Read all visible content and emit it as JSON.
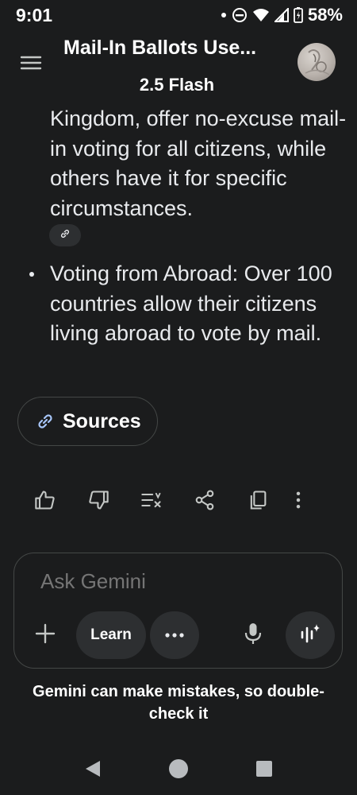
{
  "status_bar": {
    "time": "9:01",
    "battery": "58%",
    "icons": [
      "notification-dot-icon",
      "do-not-disturb-icon",
      "wifi-icon",
      "cellular-signal-icon",
      "battery-icon"
    ]
  },
  "header": {
    "title": "Mail-In Ballots Use...",
    "model": "2.5 Flash",
    "menu_icon": "hamburger-menu-icon",
    "avatar_icon": "user-avatar"
  },
  "response": {
    "paragraph_1": "Kingdom, offer no-excuse mail-in voting for all citizens, while others have it for specific circumstances.",
    "bullet_1": "Voting from Abroad: Over 100 countries allow their citizens living abroad to vote by mail.",
    "citation_icon": "link-icon",
    "sources_label": "Sources"
  },
  "actions": [
    {
      "name": "thumbs-up-icon"
    },
    {
      "name": "thumbs-down-icon"
    },
    {
      "name": "modify-response-icon"
    },
    {
      "name": "share-icon"
    },
    {
      "name": "copy-icon"
    },
    {
      "name": "more-vert-icon"
    }
  ],
  "composer": {
    "placeholder": "Ask Gemini",
    "learn_label": "Learn",
    "plus_icon": "plus-icon",
    "more_icon": "more-horiz-icon",
    "mic_icon": "microphone-icon",
    "live_icon": "gemini-live-icon"
  },
  "disclaimer": "Gemini can make mistakes, so double-check it",
  "nav": [
    "back-icon",
    "home-icon",
    "recents-icon"
  ],
  "colors": {
    "background": "#1b1c1d",
    "text": "#e8eaed",
    "chip": "#2d2f31",
    "border": "#444746",
    "link_accent": "#a8c7fa"
  }
}
